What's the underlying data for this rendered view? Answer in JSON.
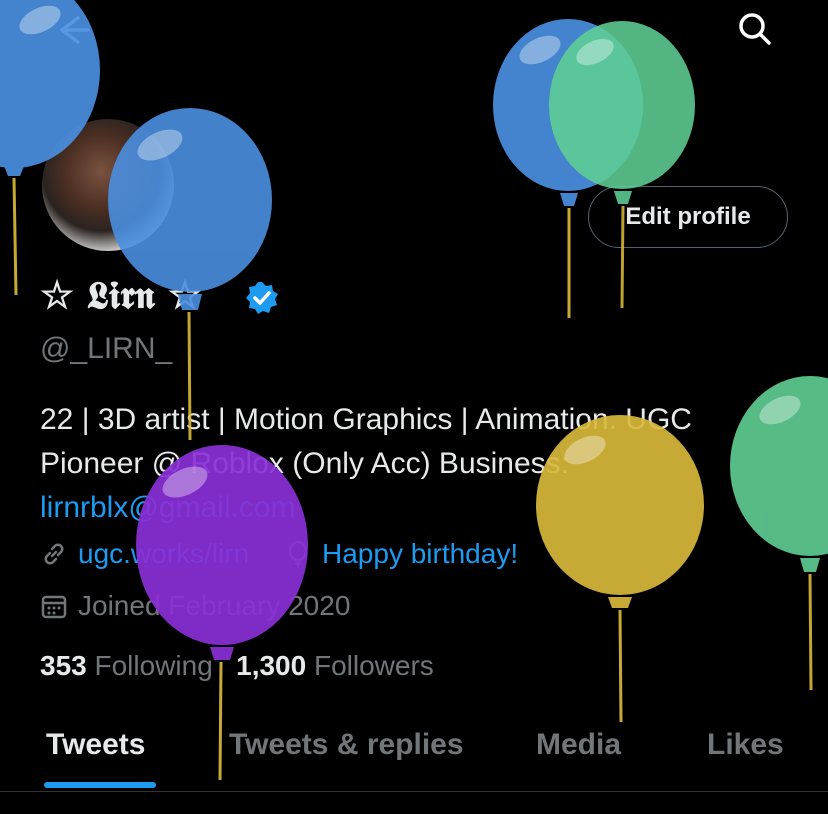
{
  "header": {
    "back_icon": "arrow-left-icon",
    "search_icon": "search-icon"
  },
  "profile": {
    "display_name": "☆ 𝕷𝖎𝖗𝖓 ☆",
    "handle": "@_LIRN_",
    "verified_icon": "verified-badge-icon",
    "edit_label": "Edit profile",
    "bio_line1": "22 | 3D artist | Motion Graphics | Animation. UGC",
    "bio_line2": "Pioneer @ Roblox (Only Acc) Business:",
    "bio_email": "lirnrblx@gmail.com",
    "website": "ugc.works/lirn",
    "birthday": "Happy birthday!",
    "joined": "Joined February 2020",
    "following_count": "353",
    "following_label": "Following",
    "followers_count": "1,300",
    "followers_label": "Followers"
  },
  "tabs": [
    {
      "label": "Tweets"
    },
    {
      "label": "Tweets & replies"
    },
    {
      "label": "Media"
    },
    {
      "label": "Likes"
    }
  ],
  "colors": {
    "accent": "#1d9bf0",
    "background": "#000000",
    "balloon_blue": "#4a8fe0",
    "balloon_green": "#5fcf94",
    "balloon_purple": "#8a2fd6",
    "balloon_yellow": "#d8b93a"
  }
}
